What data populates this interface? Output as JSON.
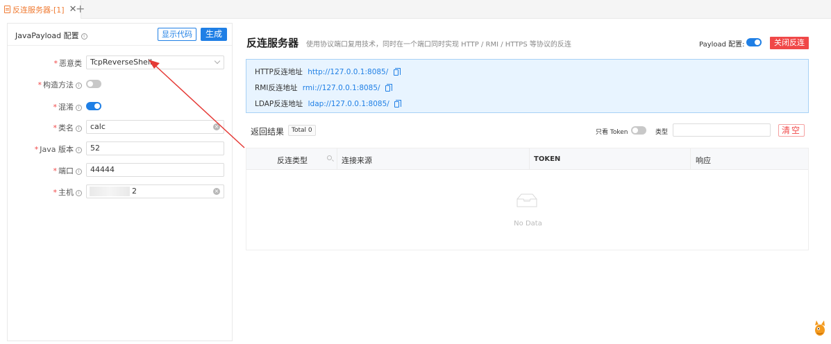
{
  "tabbar": {
    "tab_label": "反连服务器-[1]",
    "close_glyph": "✕",
    "add_glyph": "+"
  },
  "left_panel": {
    "title": "JavaPayload 配置",
    "info_glyph": "i",
    "show_code_label": "显示代码",
    "generate_label": "生成",
    "fields": {
      "malicious_class": {
        "label": "恶意类",
        "value": "TcpReverseShell"
      },
      "constructor": {
        "label": "构造方法",
        "enabled": false
      },
      "obfuscate": {
        "label": "混淆",
        "enabled": true
      },
      "class_name": {
        "label": "类名",
        "value": "calc"
      },
      "java_version": {
        "label": "Java 版本",
        "value": "52"
      },
      "port": {
        "label": "端口",
        "value": "44444"
      },
      "host": {
        "label": "主机",
        "value": "2"
      }
    },
    "required_mark": "*",
    "clear_glyph": "×"
  },
  "server": {
    "title": "反连服务器",
    "description": "使用协议端口复用技术，同时在一个端口同时实现 HTTP / RMI / HTTPS 等协议的反连",
    "payload_config_label": "Payload 配置:",
    "payload_config_enabled": true,
    "close_reverse_label": "关闭反连"
  },
  "addresses": [
    {
      "label": "HTTP反连地址",
      "url": "http://127.0.0.1:8085/"
    },
    {
      "label": "RMI反连地址",
      "url": "rmi://127.0.0.1:8085/"
    },
    {
      "label": "LDAP反连地址",
      "url": "ldap://127.0.0.1:8085/"
    }
  ],
  "results": {
    "label": "返回结果",
    "total_badge": "Total 0",
    "only_token_label": "只看 Token",
    "only_token_enabled": false,
    "type_label": "类型",
    "clear_label": "清空"
  },
  "table": {
    "columns": [
      "反连类型",
      "连接来源",
      "TOKEN",
      "响应"
    ],
    "empty_text": "No Data"
  },
  "colors": {
    "accent": "#1f7fe5",
    "danger": "#f04848",
    "tab_orange": "#f07b33",
    "addr_bg": "#e8f4ff"
  }
}
